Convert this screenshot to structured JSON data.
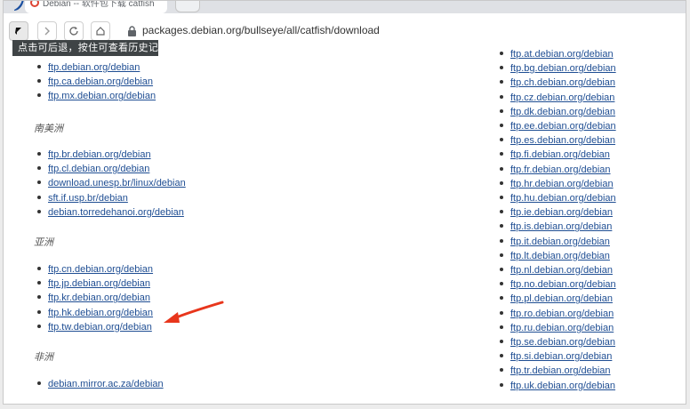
{
  "browser": {
    "tab_title": "Debian -- 软件包下载 catfish",
    "url": "packages.debian.org/bullseye/all/catfish/download",
    "back_tooltip": "点击可后退，按住可查看历史记录"
  },
  "content": {
    "left_column": [
      {
        "heading": "",
        "mirrors": [
          "ftp.debian.org/debian",
          "ftp.ca.debian.org/debian",
          "ftp.mx.debian.org/debian"
        ]
      },
      {
        "heading": "南美洲",
        "mirrors": [
          "ftp.br.debian.org/debian",
          "ftp.cl.debian.org/debian",
          "download.unesp.br/linux/debian",
          "sft.if.usp.br/debian",
          "debian.torredehanoi.org/debian"
        ]
      },
      {
        "heading": "亚洲",
        "mirrors": [
          "ftp.cn.debian.org/debian",
          "ftp.jp.debian.org/debian",
          "ftp.kr.debian.org/debian",
          "ftp.hk.debian.org/debian",
          "ftp.tw.debian.org/debian"
        ]
      },
      {
        "heading": "非洲",
        "mirrors": [
          "debian.mirror.ac.za/debian"
        ]
      }
    ],
    "right_column": [
      "ftp.at.debian.org/debian",
      "ftp.bg.debian.org/debian",
      "ftp.ch.debian.org/debian",
      "ftp.cz.debian.org/debian",
      "ftp.dk.debian.org/debian",
      "ftp.ee.debian.org/debian",
      "ftp.es.debian.org/debian",
      "ftp.fi.debian.org/debian",
      "ftp.fr.debian.org/debian",
      "ftp.hr.debian.org/debian",
      "ftp.hu.debian.org/debian",
      "ftp.ie.debian.org/debian",
      "ftp.is.debian.org/debian",
      "ftp.it.debian.org/debian",
      "ftp.lt.debian.org/debian",
      "ftp.nl.debian.org/debian",
      "ftp.no.debian.org/debian",
      "ftp.pl.debian.org/debian",
      "ftp.ro.debian.org/debian",
      "ftp.ru.debian.org/debian",
      "ftp.se.debian.org/debian",
      "ftp.si.debian.org/debian",
      "ftp.tr.debian.org/debian",
      "ftp.uk.debian.org/debian"
    ]
  },
  "icons": {
    "back": "back-arrow-icon",
    "forward": "forward-arrow-icon",
    "reload": "reload-icon",
    "home": "home-icon",
    "lock": "lock-icon",
    "annotation": "red-arrow-annotation"
  },
  "colors": {
    "link": "#1f4e93",
    "tooltip_bg": "#3f4446",
    "annotation": "#e8361c"
  }
}
